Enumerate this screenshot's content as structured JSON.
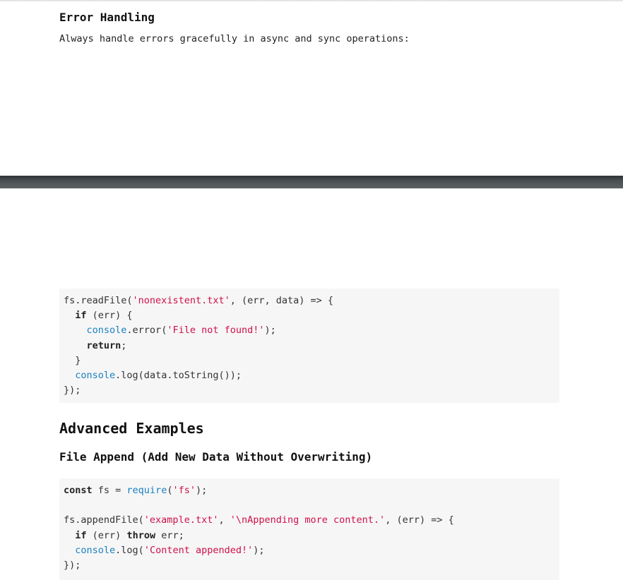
{
  "section_error": {
    "heading": "Error Handling",
    "intro": "Always handle errors gracefully in async and sync operations:"
  },
  "code_error": {
    "lines": [
      [
        {
          "t": "fs.readFile(",
          "c": "plain"
        },
        {
          "t": "'nonexistent.txt'",
          "c": "str"
        },
        {
          "t": ", (err, data) => {",
          "c": "plain"
        }
      ],
      [
        {
          "t": "  ",
          "c": "plain"
        },
        {
          "t": "if",
          "c": "kw"
        },
        {
          "t": " (err) {",
          "c": "plain"
        }
      ],
      [
        {
          "t": "    ",
          "c": "plain"
        },
        {
          "t": "console",
          "c": "bi"
        },
        {
          "t": ".error(",
          "c": "plain"
        },
        {
          "t": "'File not found!'",
          "c": "str"
        },
        {
          "t": ");",
          "c": "plain"
        }
      ],
      [
        {
          "t": "    ",
          "c": "plain"
        },
        {
          "t": "return",
          "c": "kw"
        },
        {
          "t": ";",
          "c": "plain"
        }
      ],
      [
        {
          "t": "  }",
          "c": "plain"
        }
      ],
      [
        {
          "t": "  ",
          "c": "plain"
        },
        {
          "t": "console",
          "c": "bi"
        },
        {
          "t": ".log(data.toString());",
          "c": "plain"
        }
      ],
      [
        {
          "t": "});",
          "c": "plain"
        }
      ]
    ]
  },
  "section_advanced": {
    "heading": "Advanced Examples",
    "subheading": "File Append (Add New Data Without Overwriting)"
  },
  "code_append": {
    "lines": [
      [
        {
          "t": "const",
          "c": "kw"
        },
        {
          "t": " fs = ",
          "c": "plain"
        },
        {
          "t": "require",
          "c": "bi"
        },
        {
          "t": "(",
          "c": "plain"
        },
        {
          "t": "'fs'",
          "c": "str"
        },
        {
          "t": ");",
          "c": "plain"
        }
      ],
      [
        {
          "t": "",
          "c": "plain"
        }
      ],
      [
        {
          "t": "fs.appendFile(",
          "c": "plain"
        },
        {
          "t": "'example.txt'",
          "c": "str"
        },
        {
          "t": ", ",
          "c": "plain"
        },
        {
          "t": "'\\nAppending more content.'",
          "c": "str"
        },
        {
          "t": ", (err) => {",
          "c": "plain"
        }
      ],
      [
        {
          "t": "  ",
          "c": "plain"
        },
        {
          "t": "if",
          "c": "kw"
        },
        {
          "t": " (err) ",
          "c": "plain"
        },
        {
          "t": "throw",
          "c": "kw"
        },
        {
          "t": " err;",
          "c": "plain"
        }
      ],
      [
        {
          "t": "  ",
          "c": "plain"
        },
        {
          "t": "console",
          "c": "bi"
        },
        {
          "t": ".log(",
          "c": "plain"
        },
        {
          "t": "'Content appended!'",
          "c": "str"
        },
        {
          "t": ");",
          "c": "plain"
        }
      ],
      [
        {
          "t": "});",
          "c": "plain"
        }
      ]
    ]
  },
  "colors": {
    "string": "#d0104a",
    "builtin": "#1a7fc1",
    "code_background": "#f6f6f6",
    "page_break": "#4a4f52"
  }
}
